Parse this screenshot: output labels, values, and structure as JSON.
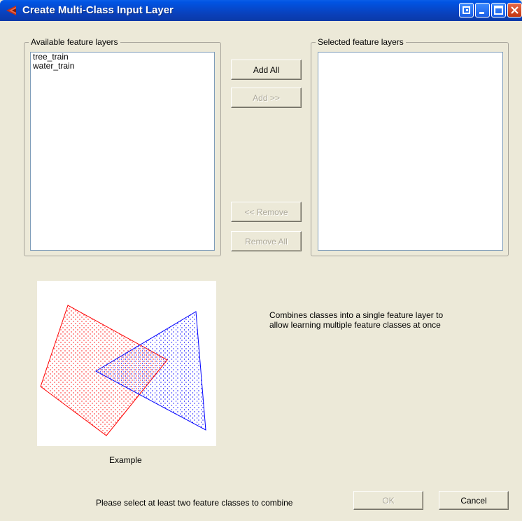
{
  "window": {
    "title": "Create Multi-Class Input Layer"
  },
  "available": {
    "label": "Available feature layers",
    "items": [
      "tree_train",
      "water_train"
    ]
  },
  "selected": {
    "label": "Selected feature layers",
    "items": []
  },
  "buttons": {
    "add_all": "Add All",
    "add": "Add >>",
    "remove": "<< Remove",
    "remove_all": "Remove All",
    "ok": "OK",
    "cancel": "Cancel"
  },
  "description": {
    "line1": "Combines classes into a single feature layer to",
    "line2": "allow learning multiple feature classes at once"
  },
  "example": {
    "caption": "Example"
  },
  "status": "Please select at least two feature classes to combine",
  "colors": {
    "titlebar": "#0a3fb8",
    "red_class": "#ff0000",
    "blue_class": "#0000ff",
    "background": "#ece9d8"
  }
}
